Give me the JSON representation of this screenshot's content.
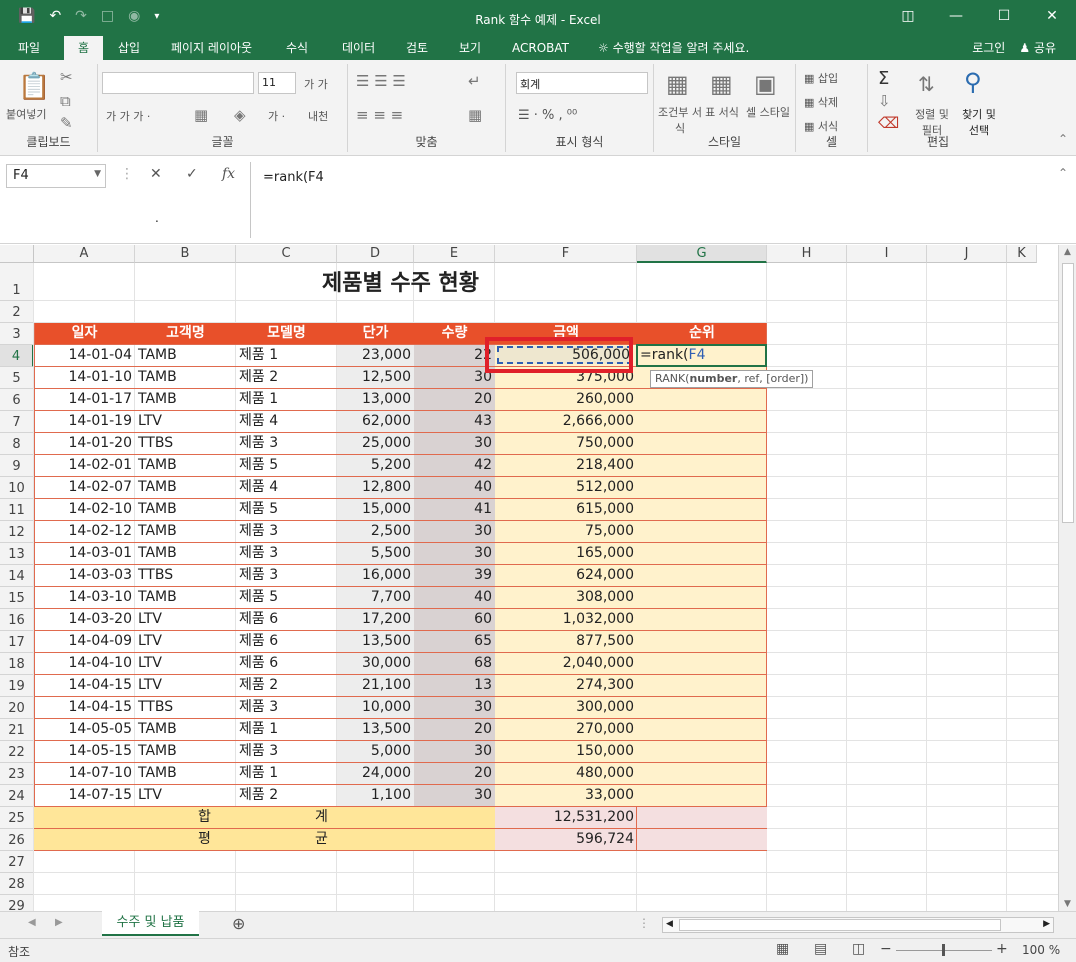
{
  "window": {
    "title": "Rank 함수 예제 - Excel"
  },
  "tabs": [
    {
      "label": "파일"
    },
    {
      "label": "홈"
    },
    {
      "label": "삽입"
    },
    {
      "label": "페이지 레이아웃"
    },
    {
      "label": "수식"
    },
    {
      "label": "데이터"
    },
    {
      "label": "검토"
    },
    {
      "label": "보기"
    },
    {
      "label": "ACROBAT"
    },
    {
      "label": "수행할 작업을 알려 주세요."
    }
  ],
  "account": {
    "login": "로그인",
    "share": "공유"
  },
  "ribbon": {
    "paste": "붙여넣기",
    "font_size": "11",
    "number_format": "회계",
    "groups": [
      "클립보드",
      "글꼴",
      "맞춤",
      "표시 형식",
      "스타일",
      "셀",
      "편집"
    ],
    "cond_format": "조건부 서식",
    "table_format": "표 서식",
    "cell_style": "셀 스타일",
    "insert": "삽입",
    "delete": "삭제",
    "format": "서식",
    "sort": "정렬 및 필터",
    "find": "찾기 및 선택"
  },
  "formula_bar": {
    "name_box": "F4",
    "formula": "=rank(F4"
  },
  "columns": [
    "A",
    "B",
    "C",
    "D",
    "E",
    "F",
    "G",
    "H",
    "I",
    "J",
    "K"
  ],
  "sheet": {
    "title": "제품별 수주 현황",
    "headers": [
      "일자",
      "고객명",
      "모델명",
      "단가",
      "수량",
      "금액",
      "순위"
    ],
    "rows": [
      [
        "14-01-04",
        "TAMB",
        "제품 1",
        "23,000",
        "22",
        "506,000"
      ],
      [
        "14-01-10",
        "TAMB",
        "제품 2",
        "12,500",
        "30",
        "375,000"
      ],
      [
        "14-01-17",
        "TAMB",
        "제품 1",
        "13,000",
        "20",
        "260,000"
      ],
      [
        "14-01-19",
        "LTV",
        "제품 4",
        "62,000",
        "43",
        "2,666,000"
      ],
      [
        "14-01-20",
        "TTBS",
        "제품 3",
        "25,000",
        "30",
        "750,000"
      ],
      [
        "14-02-01",
        "TAMB",
        "제품 5",
        "5,200",
        "42",
        "218,400"
      ],
      [
        "14-02-07",
        "TAMB",
        "제품 4",
        "12,800",
        "40",
        "512,000"
      ],
      [
        "14-02-10",
        "TAMB",
        "제품 5",
        "15,000",
        "41",
        "615,000"
      ],
      [
        "14-02-12",
        "TAMB",
        "제품 3",
        "2,500",
        "30",
        "75,000"
      ],
      [
        "14-03-01",
        "TAMB",
        "제품 3",
        "5,500",
        "30",
        "165,000"
      ],
      [
        "14-03-03",
        "TTBS",
        "제품 3",
        "16,000",
        "39",
        "624,000"
      ],
      [
        "14-03-10",
        "TAMB",
        "제품 5",
        "7,700",
        "40",
        "308,000"
      ],
      [
        "14-03-20",
        "LTV",
        "제품 6",
        "17,200",
        "60",
        "1,032,000"
      ],
      [
        "14-04-09",
        "LTV",
        "제품 6",
        "13,500",
        "65",
        "877,500"
      ],
      [
        "14-04-10",
        "LTV",
        "제품 6",
        "30,000",
        "68",
        "2,040,000"
      ],
      [
        "14-04-15",
        "LTV",
        "제품 2",
        "21,100",
        "13",
        "274,300"
      ],
      [
        "14-04-15",
        "TTBS",
        "제품 3",
        "10,000",
        "30",
        "300,000"
      ],
      [
        "14-05-05",
        "TAMB",
        "제품 1",
        "13,500",
        "20",
        "270,000"
      ],
      [
        "14-05-15",
        "TAMB",
        "제품 3",
        "5,000",
        "30",
        "150,000"
      ],
      [
        "14-07-10",
        "TAMB",
        "제품 1",
        "24,000",
        "20",
        "480,000"
      ],
      [
        "14-07-15",
        "LTV",
        "제품 2",
        "1,100",
        "30",
        "33,000"
      ]
    ],
    "total_label": [
      "합",
      "계"
    ],
    "total_value": "12,531,200",
    "avg_label": [
      "평",
      "균"
    ],
    "avg_value": "596,724",
    "editing_cell": "=rank(",
    "editing_ref": "F4"
  },
  "tooltip": {
    "fn": "RANK(",
    "arg1": "number",
    "rest": ", ref, [order])"
  },
  "sheet_tab": "수주 및 납품",
  "status": {
    "mode": "참조",
    "zoom": "100 %"
  },
  "colors": {
    "excel_green": "#217346",
    "header_fill": "#e8502a",
    "total_fill": "#ffe699",
    "amount_fill": "#fff2cc",
    "qty_fill": "#d9d2d2"
  }
}
